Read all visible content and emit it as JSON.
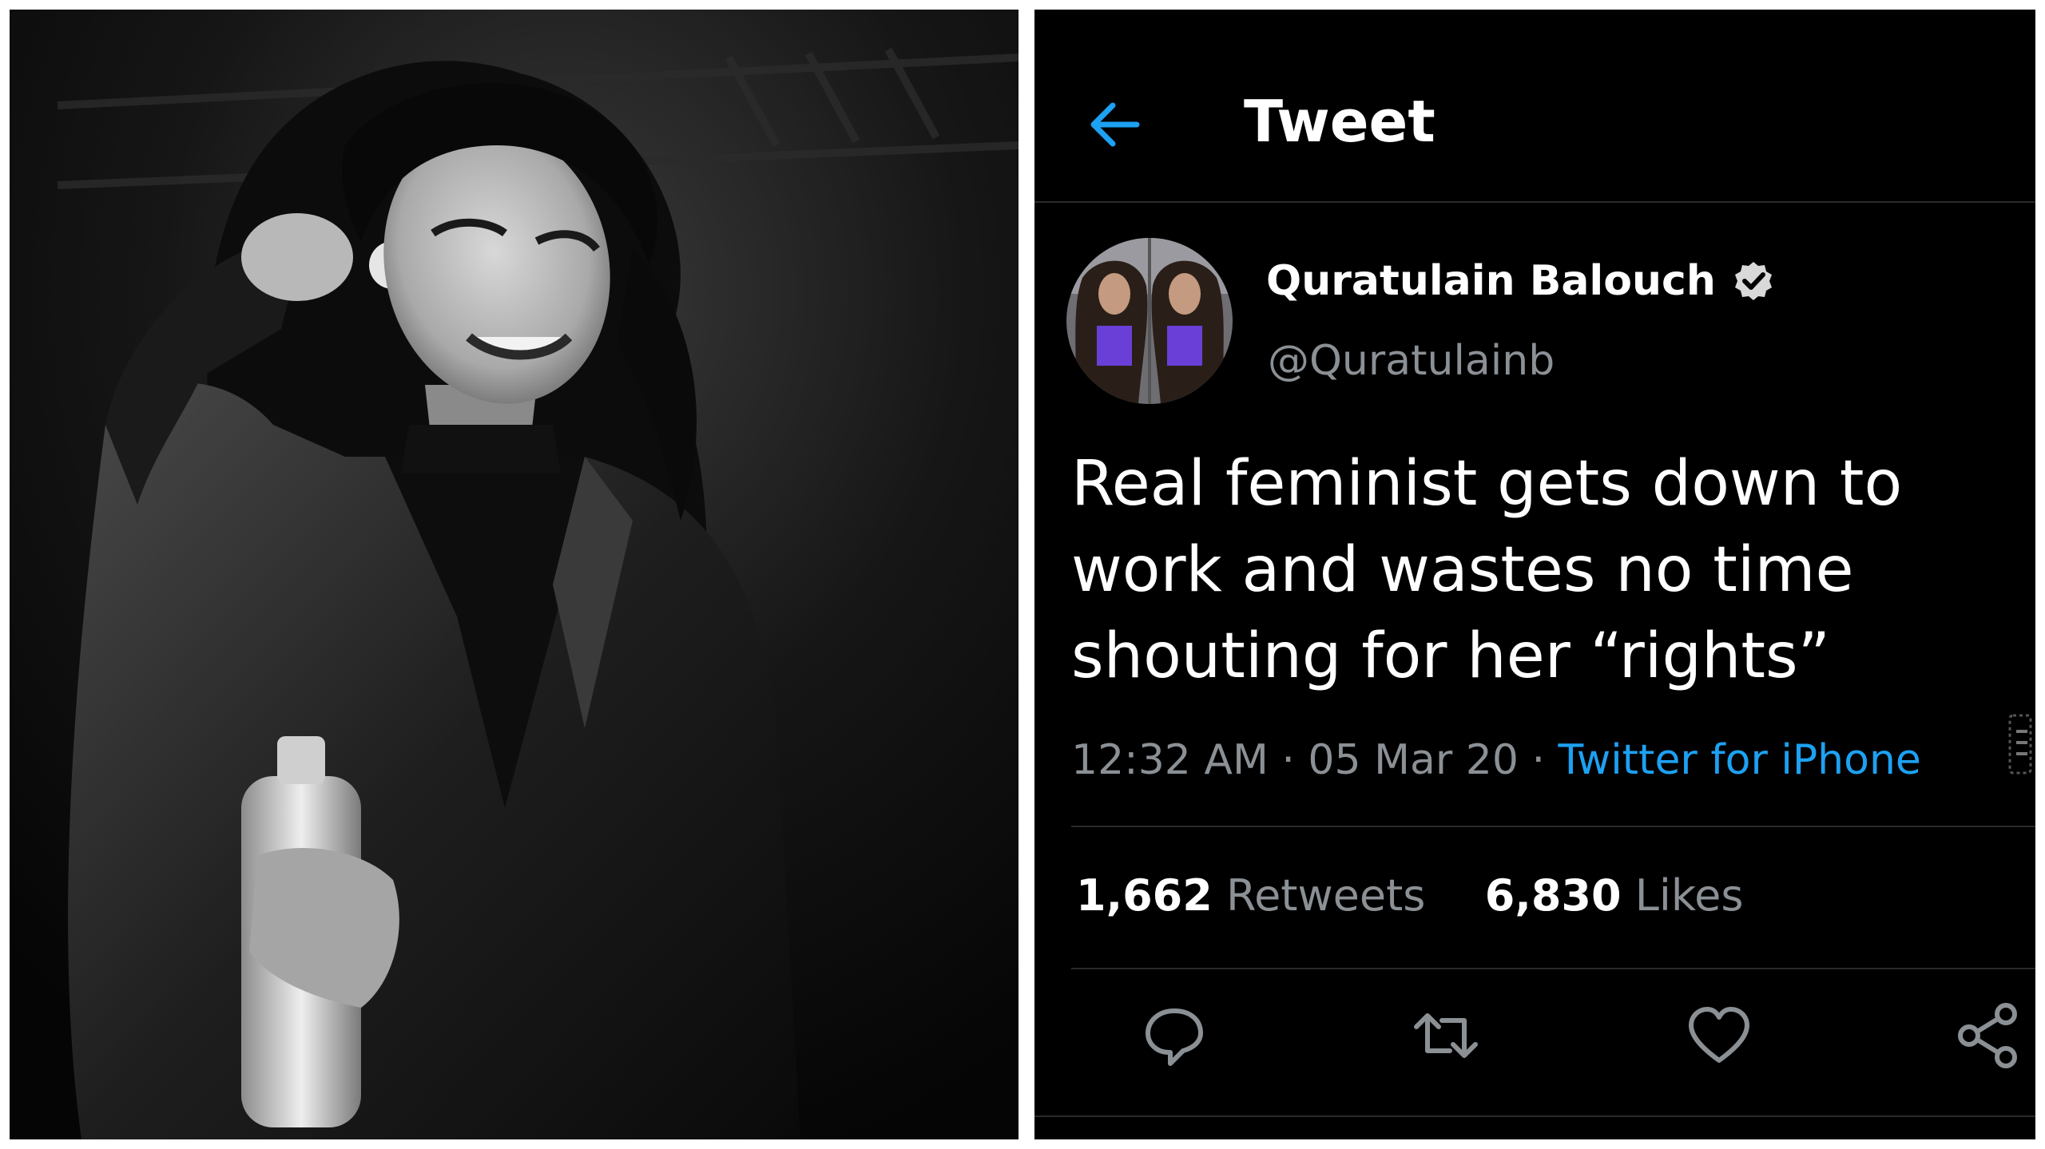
{
  "header": {
    "title": "Tweet",
    "back_icon": "arrow-left-icon"
  },
  "tweet": {
    "author_name": "Quratulain Balouch",
    "author_handle": "@Quratulainb",
    "verified_icon": "verified-badge-icon",
    "text": "Real feminist gets down to work and wastes no time shouting for her “rights”",
    "time": "12:32 AM",
    "separator": " · ",
    "date": "05 Mar 20",
    "source": "Twitter for iPhone",
    "retweets_count": "1,662",
    "retweets_label": "Retweets",
    "likes_count": "6,830",
    "likes_label": "Likes"
  },
  "actions": [
    {
      "name": "reply",
      "icon": "reply-icon"
    },
    {
      "name": "retweet",
      "icon": "retweet-icon"
    },
    {
      "name": "like",
      "icon": "heart-icon"
    },
    {
      "name": "share",
      "icon": "share-icon"
    }
  ],
  "colors": {
    "background": "#000000",
    "accent": "#1da1f2",
    "muted": "#8b9095",
    "text": "#ffffff"
  }
}
